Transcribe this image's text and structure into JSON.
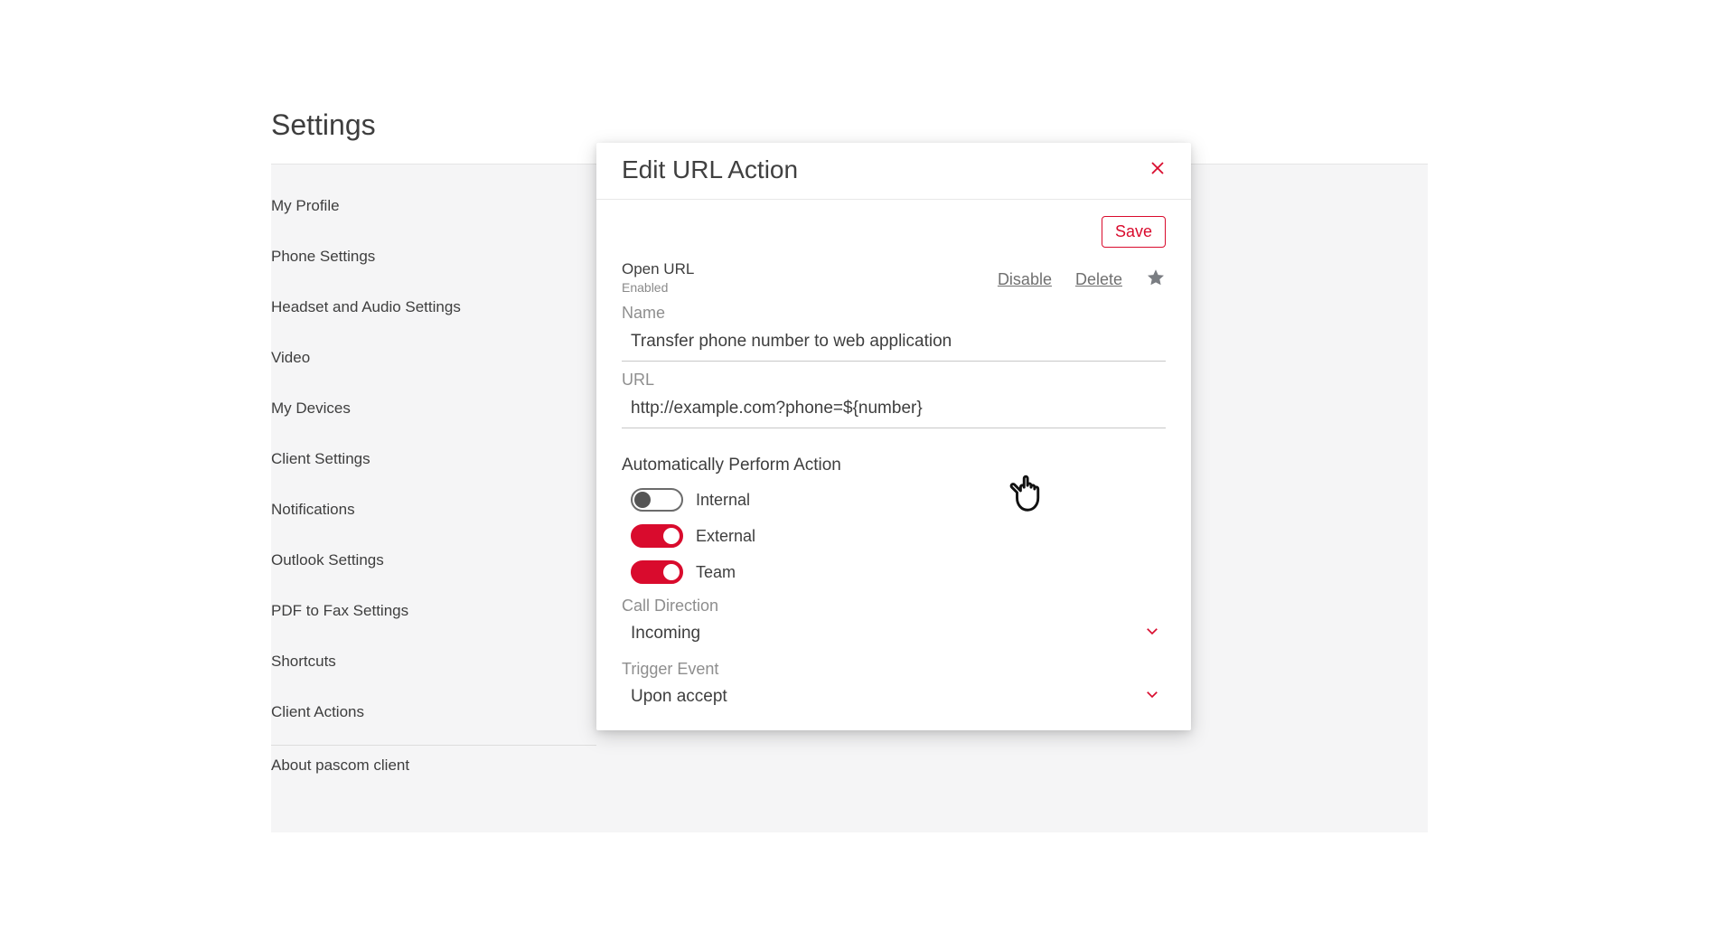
{
  "page": {
    "title": "Settings"
  },
  "sidebar": {
    "items": [
      "My Profile",
      "Phone Settings",
      "Headset and Audio Settings",
      "Video",
      "My Devices",
      "Client Settings",
      "Notifications",
      "Outlook Settings",
      "PDF to Fax Settings",
      "Shortcuts",
      "Client Actions"
    ],
    "about": "About pascom client"
  },
  "modal": {
    "title": "Edit URL Action",
    "save": "Save",
    "action_type": "Open URL",
    "action_status": "Enabled",
    "disable": "Disable",
    "delete": "Delete",
    "name_label": "Name",
    "name_value": "Transfer phone number to web application",
    "url_label": "URL",
    "url_value": "http://example.com?phone=${number}",
    "auto_section": "Automatically Perform Action",
    "toggles": {
      "internal": {
        "label": "Internal",
        "on": false
      },
      "external": {
        "label": "External",
        "on": true
      },
      "team": {
        "label": "Team",
        "on": true
      }
    },
    "call_direction_label": "Call Direction",
    "call_direction_value": "Incoming",
    "trigger_label": "Trigger Event",
    "trigger_value": "Upon accept"
  },
  "colors": {
    "accent": "#d90b2d"
  }
}
